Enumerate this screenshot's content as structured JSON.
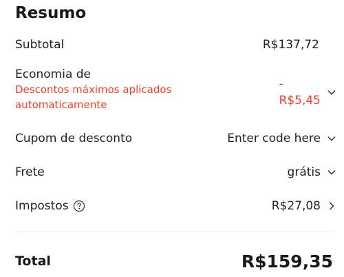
{
  "summary": {
    "title": "Resumo",
    "subtotal_label": "Subtotal",
    "subtotal_value": "R$137,72",
    "savings_label": "Economia de",
    "savings_note": "Descontos máximos aplicados automaticamente",
    "savings_sign": "-",
    "savings_value": "R$5,45",
    "coupon_label": "Cupom de desconto",
    "coupon_value": "Enter code here",
    "shipping_label": "Frete",
    "shipping_value": "grátis",
    "taxes_label": "Impostos",
    "taxes_value": "R$27,08",
    "total_label": "Total",
    "total_value": "R$159,35"
  },
  "icons": {
    "chevron": "chevron-down-icon",
    "arrow": "chevron-right-icon",
    "help": "help-circle-icon"
  },
  "colors": {
    "accent_red": "#fd3b20",
    "text": "#191919"
  }
}
